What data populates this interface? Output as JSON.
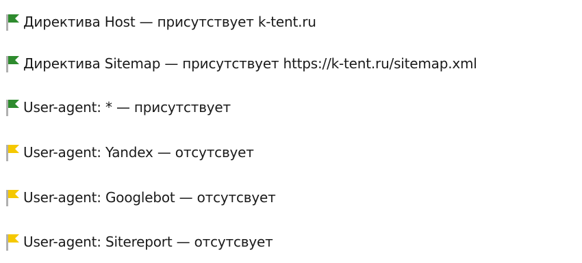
{
  "checks": [
    {
      "text": "Директива Host — присутствует k-tent.ru",
      "status": "ok",
      "flag_icon": "green-flag-icon"
    },
    {
      "text": "Директива Sitemap — присутствует https://k-tent.ru/sitemap.xml",
      "status": "ok",
      "flag_icon": "green-flag-icon"
    },
    {
      "text": "User-agent: * — присутствует",
      "status": "ok",
      "flag_icon": "green-flag-icon"
    },
    {
      "text": "User-agent: Yandex — отсутсвует",
      "status": "warning",
      "flag_icon": "yellow-flag-icon"
    },
    {
      "text": "User-agent: Googlebot — отсутсвует",
      "status": "warning",
      "flag_icon": "yellow-flag-icon"
    },
    {
      "text": "User-agent: Sitereport — отсутсвует",
      "status": "warning",
      "flag_icon": "yellow-flag-icon"
    }
  ],
  "colors": {
    "ok_flag": "#2e8b2e",
    "warning_flag": "#f5c800",
    "pole": "#b0b0b0",
    "text": "#1a1a1a"
  }
}
